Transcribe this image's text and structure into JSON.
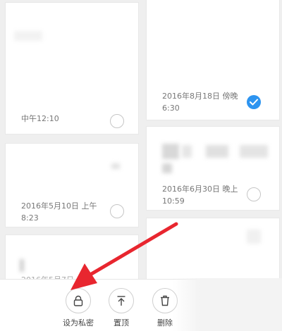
{
  "notes": [
    {
      "time": "中午12:10",
      "checked": false
    },
    {
      "time": "2016年8月18日 傍晚\n6:30",
      "checked": true
    },
    {
      "time": "2016年6月30日 晚上\n10:59",
      "checked": false
    },
    {
      "time": "2016年5月10日 上午\n8:23",
      "checked": false
    },
    {
      "time": "2016年5月7日",
      "checked": false
    }
  ],
  "toolbar": {
    "private_label": "设为私密",
    "pin_label": "置顶",
    "delete_label": "删除"
  },
  "colors": {
    "accent": "#2d94f0",
    "arrow": "#e8262f"
  },
  "icons": {
    "private": "lock-icon",
    "pin": "pin-to-top-icon",
    "delete": "trash-icon",
    "checked": "checkmark-icon"
  }
}
